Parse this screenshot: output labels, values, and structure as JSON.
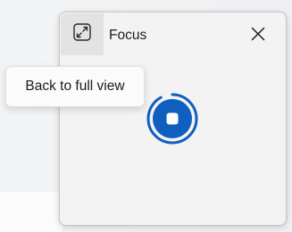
{
  "window": {
    "title": "Focus",
    "restore_icon": "compact-mode-restore-icon",
    "close_icon": "close-icon"
  },
  "tooltip": {
    "text": "Back to full view"
  },
  "session": {
    "stop_icon": "stop-icon",
    "progress": 0.92
  },
  "colors": {
    "accent": "#0f5fbf",
    "window_bg": "#f3f3f3",
    "button_hover": "#e3e3e3"
  }
}
